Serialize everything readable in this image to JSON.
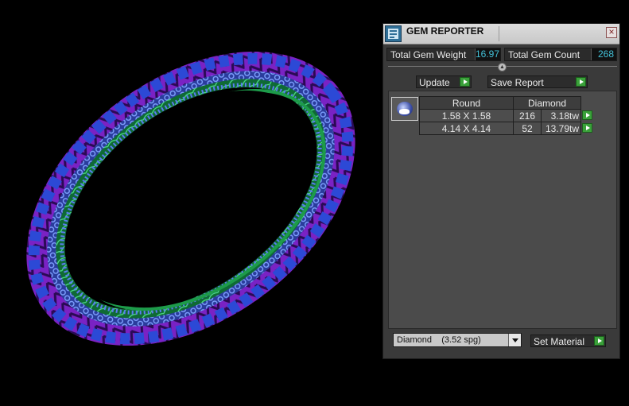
{
  "panel": {
    "title": "GEM REPORTER",
    "close_label": "×",
    "total_weight_label": "Total Gem Weight",
    "total_weight_value": "16.97",
    "total_count_label": "Total Gem Count",
    "total_count_value": "268",
    "update_label": "Update",
    "save_report_label": "Save Report",
    "table": {
      "headers": [
        "Round",
        "Diamond"
      ],
      "rows": [
        {
          "size": "1.58 X 1.58",
          "count": "216",
          "weight": "3.18tw"
        },
        {
          "size": "4.14 X 4.14",
          "count": "52",
          "weight": "13.79tw"
        }
      ]
    },
    "material_value": "Diamond    (3.52 spg)",
    "set_material_label": "Set Material"
  },
  "colors": {
    "ring_purple": "#8a2bd1",
    "ring_blue": "#3b5fe0",
    "ring_green": "#23b55a",
    "value_cyan": "#43c2d9",
    "arrow_green": "#3aa13a"
  }
}
